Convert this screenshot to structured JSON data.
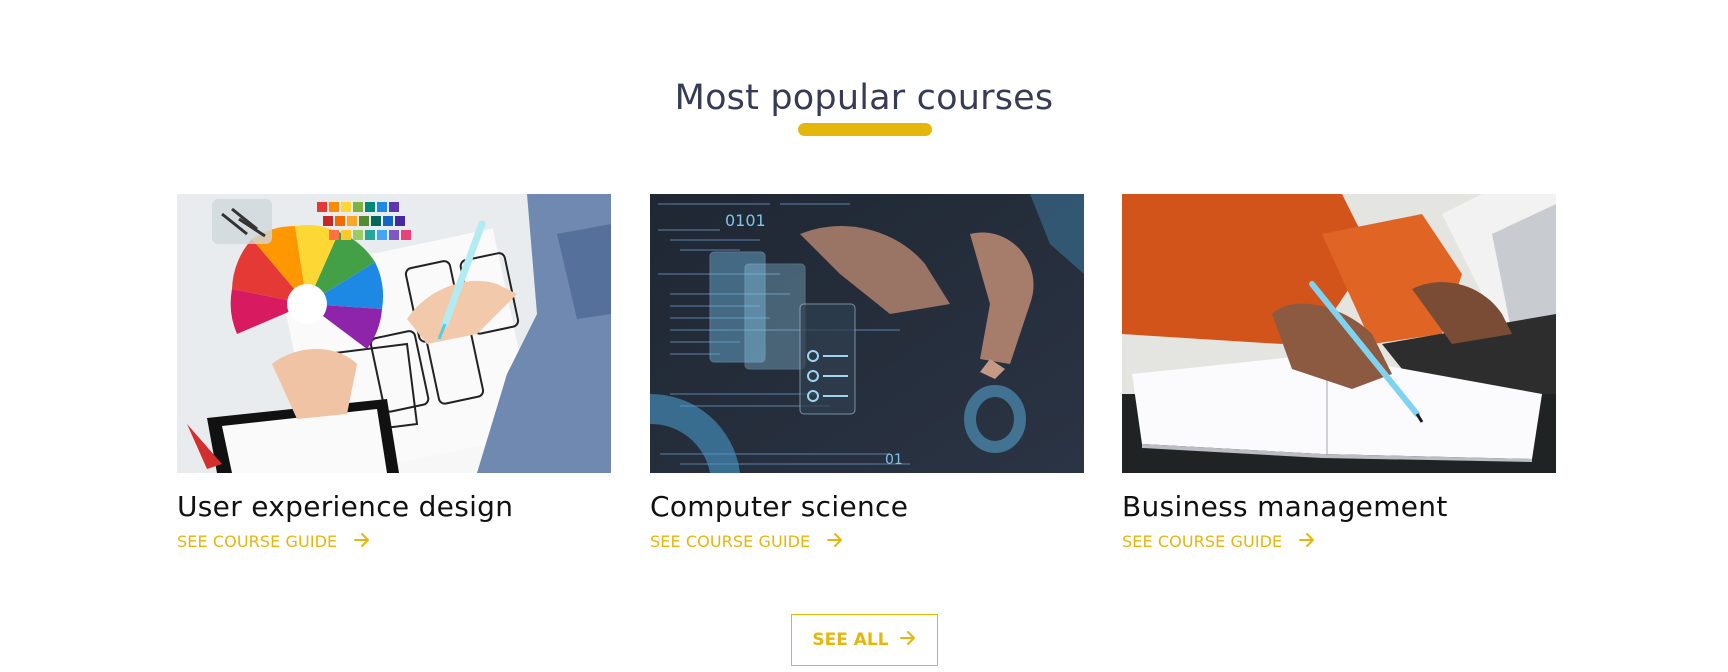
{
  "theme": {
    "accent": "#e5b60c",
    "heading": "#373b55"
  },
  "section": {
    "title": "Most popular courses"
  },
  "courses": [
    {
      "title": "User experience design",
      "link_label": "SEE COURSE GUIDE",
      "image_subject": "hands sketching wireframes with color swatches"
    },
    {
      "title": "Computer science",
      "link_label": "SEE COURSE GUIDE",
      "image_subject": "hand touching holographic code interface"
    },
    {
      "title": "Business management",
      "link_label": "SEE COURSE GUIDE",
      "image_subject": "person writing in notebook beside laptop"
    }
  ],
  "icons": {
    "link_arrow": "arrow-right-icon"
  },
  "see_all": {
    "label": "SEE ALL"
  }
}
